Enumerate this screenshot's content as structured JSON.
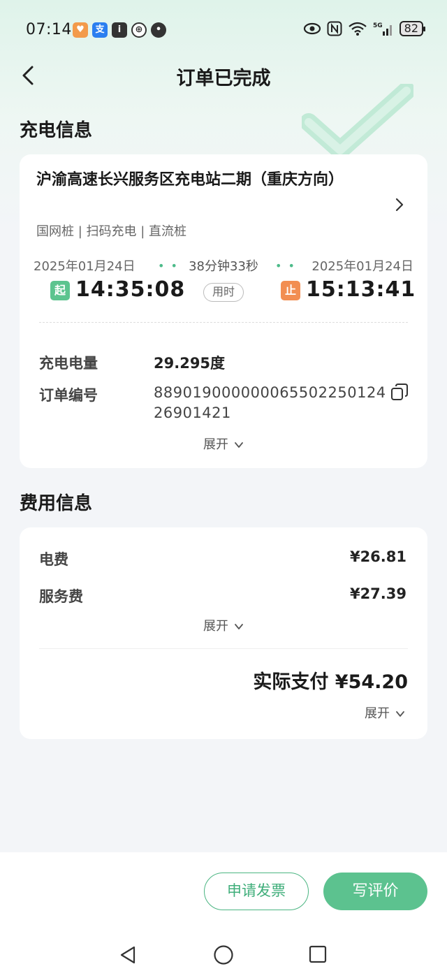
{
  "status_bar": {
    "time": "07:14",
    "battery": "82",
    "network": "5G"
  },
  "header": {
    "title": "订单已完成"
  },
  "charge_info": {
    "section_title": "充电信息",
    "station_name": "沪渝高速长兴服务区充电站二期（重庆方向）",
    "tags": "国网桩 | 扫码充电 | 直流桩",
    "start_date": "2025年01月24日",
    "end_date": "2025年01月24日",
    "duration": "38分钟33秒",
    "start_badge": "起",
    "end_badge": "止",
    "start_time": "14:35:08",
    "end_time": "15:13:41",
    "duration_pill": "用时",
    "energy_label": "充电电量",
    "energy_value": "29.295度",
    "order_label": "订单编号",
    "order_value": "889019000000065502250124 26901421",
    "expand_label": "展开"
  },
  "fee_info": {
    "section_title": "费用信息",
    "electric_label": "电费",
    "electric_value": "¥26.81",
    "service_label": "服务费",
    "service_value": "¥27.39",
    "expand_label": "展开",
    "total_label": "实际支付 ¥54.20",
    "expand_label_2": "展开"
  },
  "actions": {
    "invoice": "申请发票",
    "review": "写评价"
  },
  "colors": {
    "accent": "#5cc28f",
    "start_badge": "#5cc48f",
    "end_badge": "#f28e52"
  }
}
